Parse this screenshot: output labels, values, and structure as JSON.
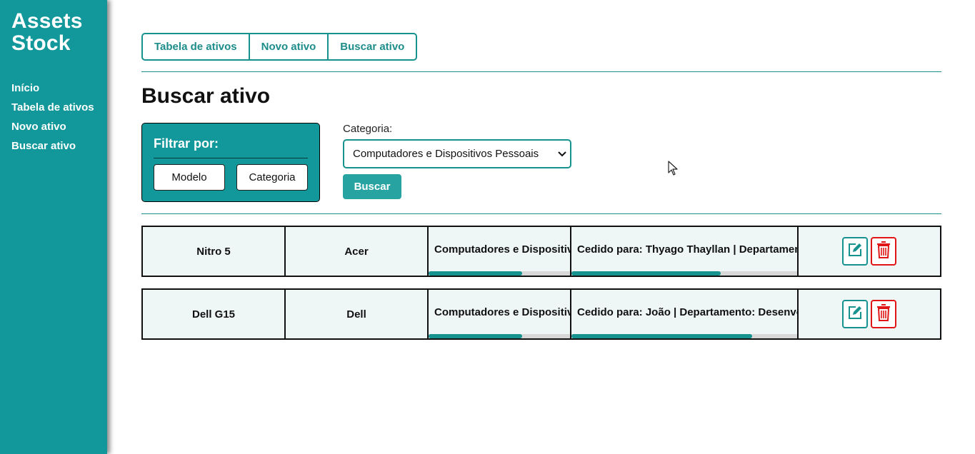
{
  "sidebar": {
    "brand": "Assets Stock",
    "items": [
      {
        "label": "Início"
      },
      {
        "label": "Tabela de ativos"
      },
      {
        "label": "Novo ativo"
      },
      {
        "label": "Buscar ativo"
      }
    ]
  },
  "tabs": [
    {
      "label": "Tabela de ativos"
    },
    {
      "label": "Novo ativo"
    },
    {
      "label": "Buscar ativo"
    }
  ],
  "page": {
    "title": "Buscar ativo"
  },
  "filter": {
    "title": "Filtrar por:",
    "modelo_label": "Modelo",
    "categoria_label": "Categoria"
  },
  "category": {
    "label": "Categoria:",
    "selected": "Computadores e Dispositivos Pessoais",
    "search_label": "Buscar"
  },
  "results": [
    {
      "model": "Nitro 5",
      "brand": "Acer",
      "category": "Computadores e Dispositivos Pessoais",
      "category_scroll": 0.66,
      "assignment": "Cedido para: Thyago Thayllan | Departamento",
      "assignment_scroll": 0.66
    },
    {
      "model": "Dell G15",
      "brand": "Dell",
      "category": "Computadores e Dispositivos Pessoais",
      "category_scroll": 0.66,
      "assignment": "Cedido para: João | Departamento: Desenvolvimento",
      "assignment_scroll": 0.8
    }
  ],
  "icons": {
    "edit": "edit-icon",
    "delete": "trash-icon",
    "cursor": "mouse-pointer-icon"
  },
  "colors": {
    "primary": "#12989a",
    "accent": "#16928f",
    "button": "#27a4a2",
    "danger": "#e01515"
  }
}
